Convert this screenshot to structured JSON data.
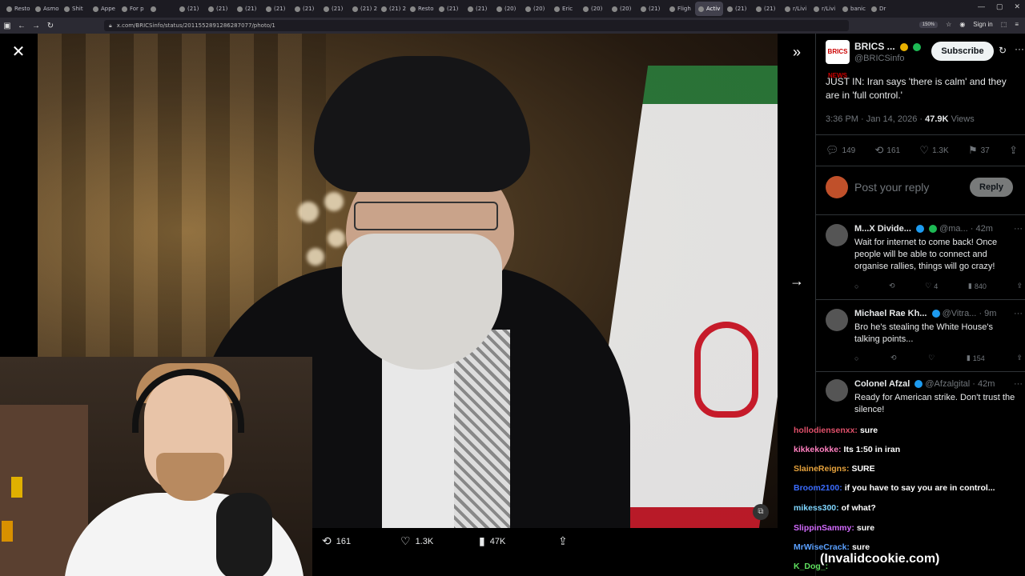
{
  "browser": {
    "tabs": [
      "Resto",
      "Asmo",
      "Shit",
      "Appe",
      "For p",
      "",
      "(21)",
      "(21)",
      "(21)",
      "(21)",
      "(21)",
      "(21)",
      "(21) 2",
      "(21) 2",
      "Resto",
      "(21)",
      "(21)",
      "(20)",
      "(20)",
      "Eric",
      "(20)",
      "(20)",
      "(21)",
      "Fligh",
      "Activ",
      "(21)",
      "(21)",
      "r/Livi",
      "r/Livi",
      "banic",
      "Dr"
    ],
    "active_tab_index": 24,
    "url": "x.com/BRICSinfo/status/2011552891286287077/photo/1",
    "zoom": "150%",
    "sign_in": "Sign in"
  },
  "media": {
    "close_icon": "close-icon",
    "actions": [
      {
        "icon": "retweet-icon",
        "glyph": "⟲",
        "count": "161"
      },
      {
        "icon": "heart-icon",
        "glyph": "♡",
        "count": "1.3K"
      },
      {
        "icon": "views-icon",
        "glyph": "▮",
        "count": "47K"
      },
      {
        "icon": "share-icon",
        "glyph": "⇪",
        "count": ""
      }
    ]
  },
  "tweet": {
    "avatar_text": "BRICS NEWS",
    "author_name": "BRICS ...",
    "author_handle": "@BRICSinfo",
    "subscribe_label": "Subscribe",
    "text": "JUST IN: Iran says 'there is calm' and they are in 'full control.'",
    "time": "3:36 PM · Jan 14, 2026 ·",
    "views_count": "47.9K",
    "views_label": "Views",
    "stats": {
      "replies": "149",
      "retweets": "161",
      "likes": "1.3K",
      "bookmarks": "37"
    },
    "reply_placeholder": "Post your reply",
    "reply_button": "Reply"
  },
  "replies": [
    {
      "name": "M...X Divide...",
      "handle": "@ma...",
      "time": "· 42m",
      "text": "Wait for internet to come back! Once people will be able to connect and organise rallies, things will go crazy!",
      "likes": "4",
      "views": "840"
    },
    {
      "name": "Michael Rae Kh...",
      "handle": "@Vitra...",
      "time": "· 9m",
      "text": "Bro he's stealing the White House's talking points...",
      "likes": "",
      "views": "154"
    },
    {
      "name": "Colonel Afzal",
      "handle": "@Afzalgital",
      "time": "· 42m",
      "text": "Ready for American strike. Don't trust the silence!",
      "likes": "",
      "views": ""
    }
  ],
  "chat": [
    {
      "user": "hollodiensenxx:",
      "msg": "sure",
      "color": "#e0506a"
    },
    {
      "user": "kikkekokke:",
      "msg": "Its 1:50 in iran",
      "color": "#ff7fbf"
    },
    {
      "user": "SlaineReigns:",
      "msg": "SURE",
      "color": "#e6a23c"
    },
    {
      "user": "Broom2100:",
      "msg": "if you have to say you are in control...",
      "color": "#3b6cff"
    },
    {
      "user": "mikess300:",
      "msg": "of what?",
      "color": "#7fd6ff"
    },
    {
      "user": "SlippinSammy:",
      "msg": "sure",
      "color": "#d36bff"
    },
    {
      "user": "MrWiseCrack:",
      "msg": "sure",
      "color": "#5aa0ff"
    },
    {
      "user": "K_Dog_:",
      "msg": "",
      "color": "#5fe05f"
    }
  ],
  "watermark": "(Invalidcookie.com)"
}
